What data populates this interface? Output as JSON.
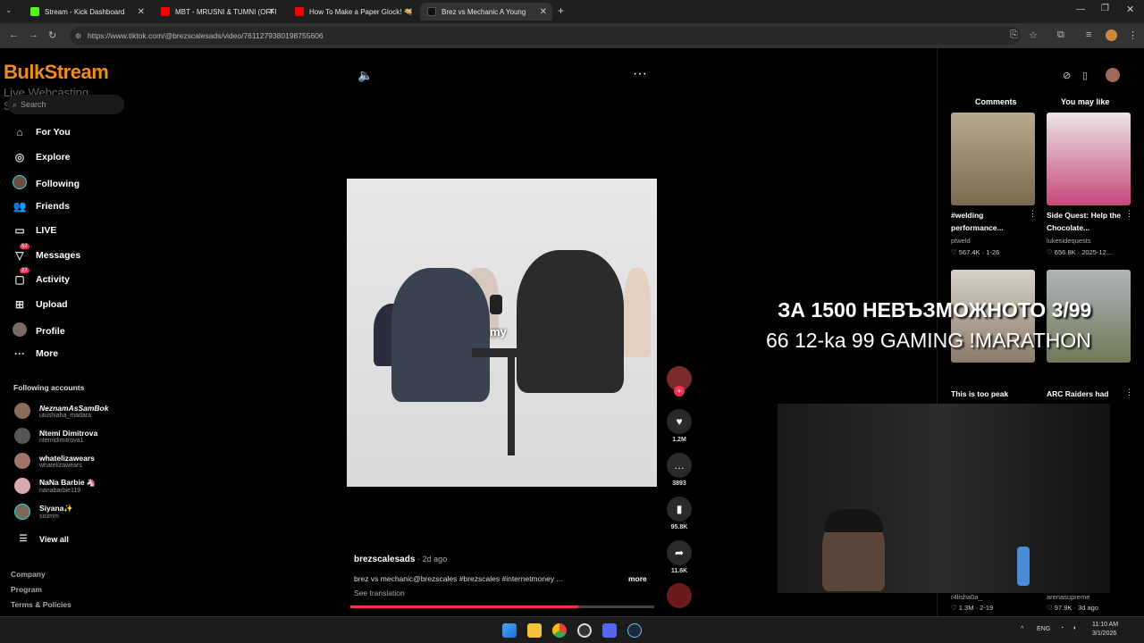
{
  "browser": {
    "tabs": [
      {
        "label": "Stream - Kick Dashboard",
        "color": "#53fc18"
      },
      {
        "label": "MBT - MRUSNI & TUMNI (OFFI",
        "color": "#ff0000"
      },
      {
        "label": "How To Make a Paper Glock! 🔫",
        "color": "#ff0000"
      },
      {
        "label": "Brez vs Mechanic A Young",
        "color": "#111111"
      }
    ],
    "url": "https://www.tiktok.com/@brezscalesads/video/7611279380198755606"
  },
  "sidebar": {
    "logo": "BulkStream",
    "logo_sub": "Live Webcasting Services",
    "search_placeholder": "Search",
    "nav": [
      {
        "label": "For You",
        "icon": "home-icon"
      },
      {
        "label": "Explore",
        "icon": "compass-icon"
      },
      {
        "label": "Following",
        "icon": "following-avatar-icon"
      },
      {
        "label": "Friends",
        "icon": "friends-icon"
      },
      {
        "label": "LIVE",
        "icon": "live-icon"
      },
      {
        "label": "Messages",
        "icon": "messages-icon",
        "badge": "57"
      },
      {
        "label": "Activity",
        "icon": "activity-icon",
        "badge": "27"
      },
      {
        "label": "Upload",
        "icon": "upload-icon"
      },
      {
        "label": "Profile",
        "icon": "profile-avatar-icon"
      },
      {
        "label": "More",
        "icon": "more-icon"
      }
    ],
    "following_title": "Following accounts",
    "accounts": [
      {
        "name": "NeznamAsSamBok",
        "handle": "utushiaha_madara"
      },
      {
        "name": "Ntemi Dimitrova",
        "handle": "ntemidimitrova1"
      },
      {
        "name": "whatelizawears",
        "handle": "whatelizawears"
      },
      {
        "name": "NaNa Barbie 🦄",
        "handle": "nanabarbie119"
      },
      {
        "name": "Siyana✨",
        "handle": "sisimm"
      }
    ],
    "view_all": "View all",
    "footer": [
      "Company",
      "Program",
      "Terms & Policies"
    ]
  },
  "video": {
    "caption_overlay": "my",
    "author": "brezscalesads",
    "date": "· 2d ago",
    "description": "brez vs mechanic@brezscales #brezscales #internetmoney ...",
    "more": "more",
    "see_translation": "See translation",
    "progress": 0.75,
    "actions": [
      {
        "icon": "heart-icon",
        "count": "1.2M"
      },
      {
        "icon": "comment-icon",
        "count": "3893"
      },
      {
        "icon": "bookmark-icon",
        "count": "95.8K"
      },
      {
        "icon": "share-icon",
        "count": "11.6K"
      }
    ]
  },
  "right": {
    "tab_comments": "Comments",
    "tab_like": "You may like",
    "cards": [
      {
        "title": "#welding performance...",
        "user": "ptweld",
        "stat": "♡ 567.4K · 1-26"
      },
      {
        "title": "Side Quest: Help the Chocolate...",
        "user": "lukesidequests",
        "stat": "♡ 656.8K · 2025-12..."
      },
      {
        "title": "This is too peak",
        "user": "",
        "stat": ""
      },
      {
        "title": "ARC Raiders had",
        "user": "",
        "stat": ""
      }
    ],
    "bottom_cards": [
      {
        "user": "r4lisha0a_",
        "stat": "♡ 1.3M · 2-19"
      },
      {
        "user": "arenasupreme",
        "stat": "♡ 97.9K · 3d ago"
      }
    ]
  },
  "stream_overlay": {
    "line1": "ЗА 1500 НЕВЪЗМОЖНОТО 3/99",
    "line2": "66 12-ka 99 GAMING !MARATHON"
  },
  "taskbar": {
    "lang": "ENG",
    "time": "11:10 AM",
    "date": "3/1/2026"
  }
}
